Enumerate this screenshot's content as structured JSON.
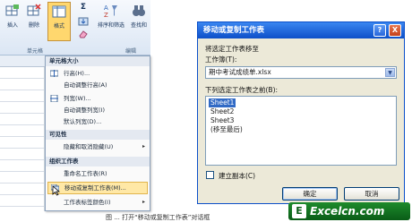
{
  "ribbon": {
    "insert_label": "插入",
    "delete_label": "删除",
    "format_label": "格式",
    "sort_filter_label": "排序和筛选",
    "find_select_label": "查找和",
    "sigma_label": "Σ",
    "cells_group_label": "单元格",
    "editing_group_label": "编辑"
  },
  "format_menu": {
    "cell_size_header": "单元格大小",
    "row_height": "行高(H)...",
    "autofit_row_height": "自动调整行高(A)",
    "column_width": "列宽(W)...",
    "autofit_column_width": "自动调整列宽(I)",
    "default_width": "默认列宽(D)...",
    "visibility_header": "可见性",
    "hide_unhide": "隐藏和取消隐藏(U)",
    "organize_sheets_header": "组织工作表",
    "rename_sheet": "重命名工作表(R)",
    "move_copy_sheet": "移动或复制工作表(M)...",
    "tab_color": "工作表标签颜色(I)"
  },
  "dialog": {
    "title": "移动或复制工作表",
    "help_glyph": "?",
    "close_glyph": "X",
    "move_to_label": "将选定工作表移至",
    "workbook_label": "工作簿(T):",
    "workbook_value": "期中考试成绩单.xlsx",
    "before_sheet_label": "下列选定工作表之前(B):",
    "sheets": [
      "Sheet1",
      "Sheet2",
      "Sheet3",
      "(移至最后)"
    ],
    "selected_sheet_index": 0,
    "create_copy_label": "建立副本(C)",
    "create_copy_checked": false,
    "ok_label": "确定",
    "cancel_label": "取消"
  },
  "caption": "图 ... 打开“移动或复制工作表”对话框",
  "watermark": {
    "icon_text": "E",
    "text": "Excelcn.com"
  },
  "colors": {
    "dialog_titlebar": "#0d4fc9",
    "selection": "#316ac5",
    "menu_highlight": "#ffe8a6",
    "watermark": "#0a5c17"
  }
}
